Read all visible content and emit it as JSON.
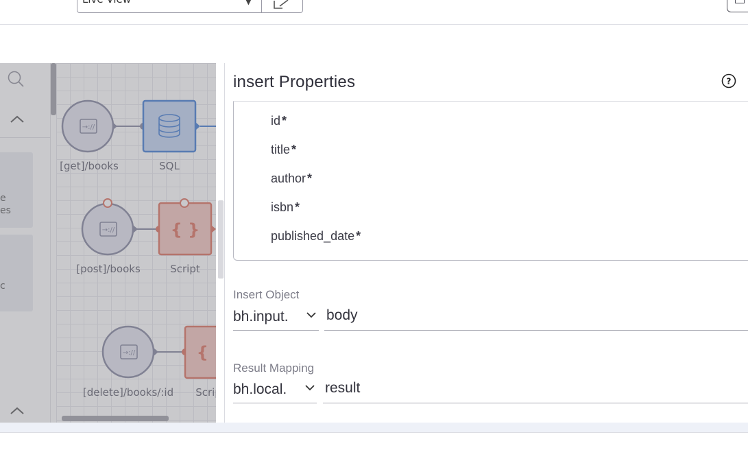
{
  "toolbar": {
    "view_select_value": "Live View",
    "view_select_caret_icon": "caret-down-icon",
    "edit_icon": "pencil-icon",
    "corner_icon": "save-icon"
  },
  "palette": {
    "search_icon": "search-icon",
    "collapse_icon": "chevron-up-icon",
    "card1_line1": "e",
    "card1_line2": "es",
    "card2_line1": "c"
  },
  "canvas": {
    "nodes": [
      {
        "label": "[get]/books",
        "type": "http-endpoint",
        "icon": "http-endpoint-icon"
      },
      {
        "label": "SQL",
        "type": "sql",
        "icon": "database-icon"
      },
      {
        "label": "[post]/books",
        "type": "http-endpoint",
        "icon": "http-endpoint-icon"
      },
      {
        "label": "Script",
        "type": "script",
        "icon": "curly-braces-icon"
      },
      {
        "label": "[delete]/books/:id",
        "type": "http-endpoint",
        "icon": "http-endpoint-icon"
      },
      {
        "label": "Script",
        "type": "script",
        "icon": "curly-braces-icon"
      }
    ],
    "colors": {
      "endpoint": "#8d8fa6",
      "sql": "#4f86d6",
      "script": "#e07a6a"
    }
  },
  "properties": {
    "title": "insert Properties",
    "help_icon": "question-circle-icon",
    "fields": [
      {
        "name": "id",
        "required_mark": "*"
      },
      {
        "name": "title",
        "required_mark": "*"
      },
      {
        "name": "author",
        "required_mark": "*"
      },
      {
        "name": "isbn",
        "required_mark": "*"
      },
      {
        "name": "published_date",
        "required_mark": "*"
      }
    ],
    "insert_object": {
      "label": "Insert Object",
      "prefix": "bh.input.",
      "value": "body"
    },
    "result_mapping": {
      "label": "Result Mapping",
      "prefix": "bh.local.",
      "value": "result"
    }
  }
}
